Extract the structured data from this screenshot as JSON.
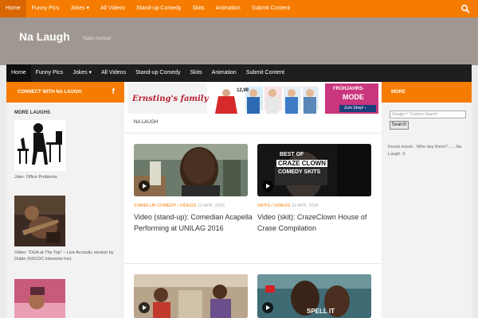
{
  "top_nav": {
    "items": [
      "Home",
      "Funny Pics",
      "Jokes ▾",
      "All Videos",
      "Stand-up Comedy",
      "Skits",
      "Animation",
      "Submit Content"
    ]
  },
  "header": {
    "logo": "Na Laugh",
    "tagline": "Naija humour"
  },
  "main_nav": {
    "items": [
      "Home",
      "Funny Pics",
      "Jokes ▾",
      "All Videos",
      "Stand-up Comedy",
      "Skits",
      "Animation",
      "Submit Content"
    ]
  },
  "left_sidebar": {
    "connect_title": "CONNECT WITH NA LAUGH:",
    "fb_glyph": "f",
    "more_laughs_title": "MORE LAUGHS",
    "items": [
      {
        "caption": "Joke: Office Problems"
      },
      {
        "caption": "Video: \"DGA at The Top\" – Live Acoustic version by Dubie (NSCDC interview fun)"
      }
    ]
  },
  "ad": {
    "brand": "Ernsting's family",
    "price": "12,99",
    "promo_line1": "FRÜHJAHRS-",
    "promo_line2": "MODE",
    "shop_button": "Zum Shop! ›"
  },
  "main": {
    "section_title": "NA LAUGH",
    "posts": [
      {
        "category": "STAND-UP COMEDY",
        "category2": "VIDEOS",
        "date": "12 APR, 2016",
        "title": "Video (stand-up): Comedian Acapella Performing at UNILAG 2016"
      },
      {
        "category": "SKITS",
        "category2": "VIDEOS",
        "date": "12 APR, 2016",
        "title": "Video (skit): CrazeClown House of Crase Compilation",
        "image_text_1": "BEST OF",
        "image_text_2": "CRAZE CLOWN",
        "image_text_3": "COMEDY SKITS"
      },
      {
        "title": ""
      },
      {
        "title": "",
        "image_text": "SPELL IT"
      }
    ]
  },
  "right_sidebar": {
    "title": "MORE",
    "search_placeholder": "Google™ Custom Search",
    "search_button": "Search",
    "joke_text": "Knock knock.. Who dey there?...... Na Laugh :3"
  },
  "colors": {
    "accent": "#f57c00",
    "nav_dark": "#1e1e1e",
    "header_bg": "#a09890"
  }
}
